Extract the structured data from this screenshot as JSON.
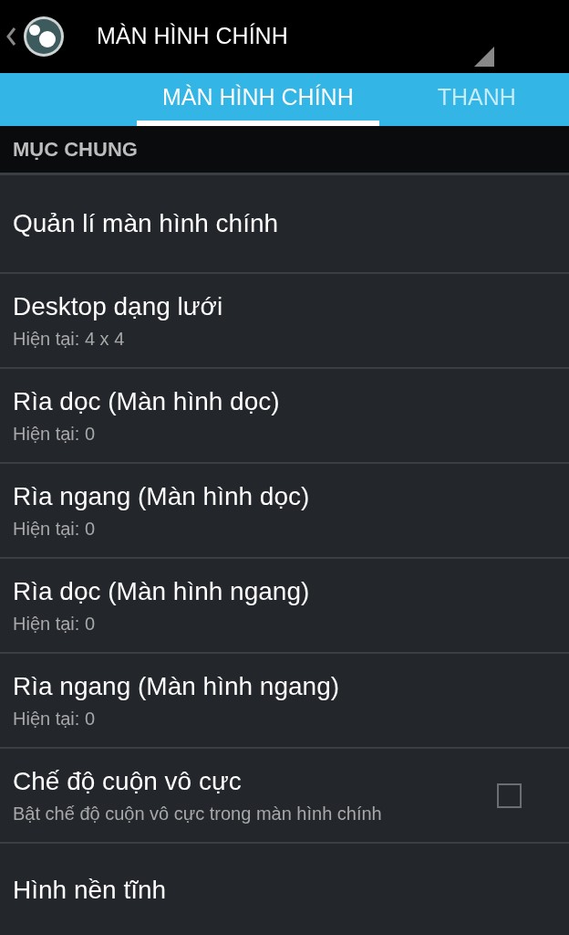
{
  "action_bar": {
    "title": "MÀN HÌNH CHÍNH"
  },
  "tabs": [
    {
      "label": "MÀN HÌNH CHÍNH",
      "selected": true
    },
    {
      "label": "THANH",
      "selected": false
    }
  ],
  "section": {
    "title": "MỤC CHUNG"
  },
  "items": [
    {
      "kind": "plain",
      "title": "Quản lí màn hình chính"
    },
    {
      "kind": "summary",
      "title": "Desktop dạng lưới",
      "summary": "Hiện tại: 4 x 4"
    },
    {
      "kind": "summary",
      "title": "Rìa dọc (Màn hình dọc)",
      "summary": "Hiện tại: 0"
    },
    {
      "kind": "summary",
      "title": "Rìa ngang (Màn hình dọc)",
      "summary": "Hiện tại: 0"
    },
    {
      "kind": "summary",
      "title": "Rìa dọc (Màn hình ngang)",
      "summary": "Hiện tại: 0"
    },
    {
      "kind": "summary",
      "title": "Rìa ngang (Màn hình ngang)",
      "summary": "Hiện tại: 0"
    },
    {
      "kind": "checkbox",
      "title": "Chế độ cuộn vô cực",
      "summary": "Bật chế độ cuộn vô cực trong màn hình chính",
      "checked": false
    },
    {
      "kind": "plain",
      "title": "Hình nền tĩnh"
    }
  ]
}
